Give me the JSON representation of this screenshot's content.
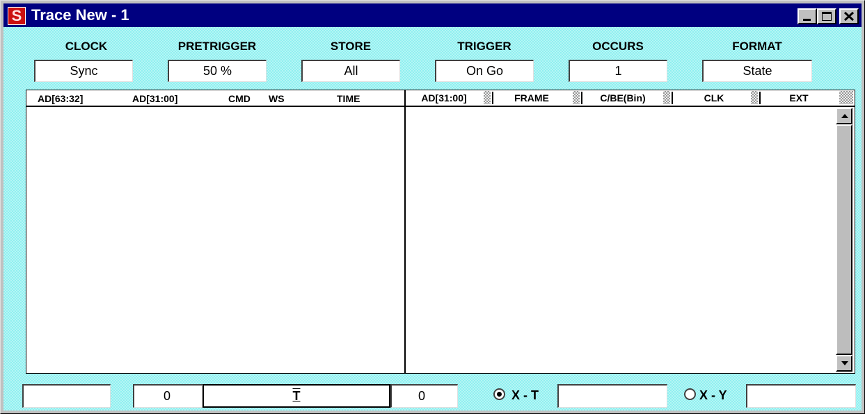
{
  "window": {
    "title": "Trace New - 1"
  },
  "settings": [
    {
      "label": "CLOCK",
      "value": "Sync"
    },
    {
      "label": "PRETRIGGER",
      "value": "50 %"
    },
    {
      "label": "STORE",
      "value": "All"
    },
    {
      "label": "TRIGGER",
      "value": "On Go"
    },
    {
      "label": "OCCURS",
      "value": "1"
    },
    {
      "label": "FORMAT",
      "value": "State"
    }
  ],
  "listing": {
    "columns": [
      "AD[63:32]",
      "AD[31:00]",
      "CMD",
      "WS",
      "TIME"
    ]
  },
  "waveform": {
    "columns": [
      "AD[31:00]",
      "FRAME",
      "C/BE(Bin)",
      "CLK",
      "EXT"
    ]
  },
  "bottom": {
    "field1": "",
    "field2": "0",
    "trigger_marker": "T",
    "field3": "0",
    "radio1_label": "X - T",
    "radio1_checked": true,
    "field4": "",
    "radio2_label": "X - Y",
    "radio2_checked": false,
    "field5": ""
  }
}
